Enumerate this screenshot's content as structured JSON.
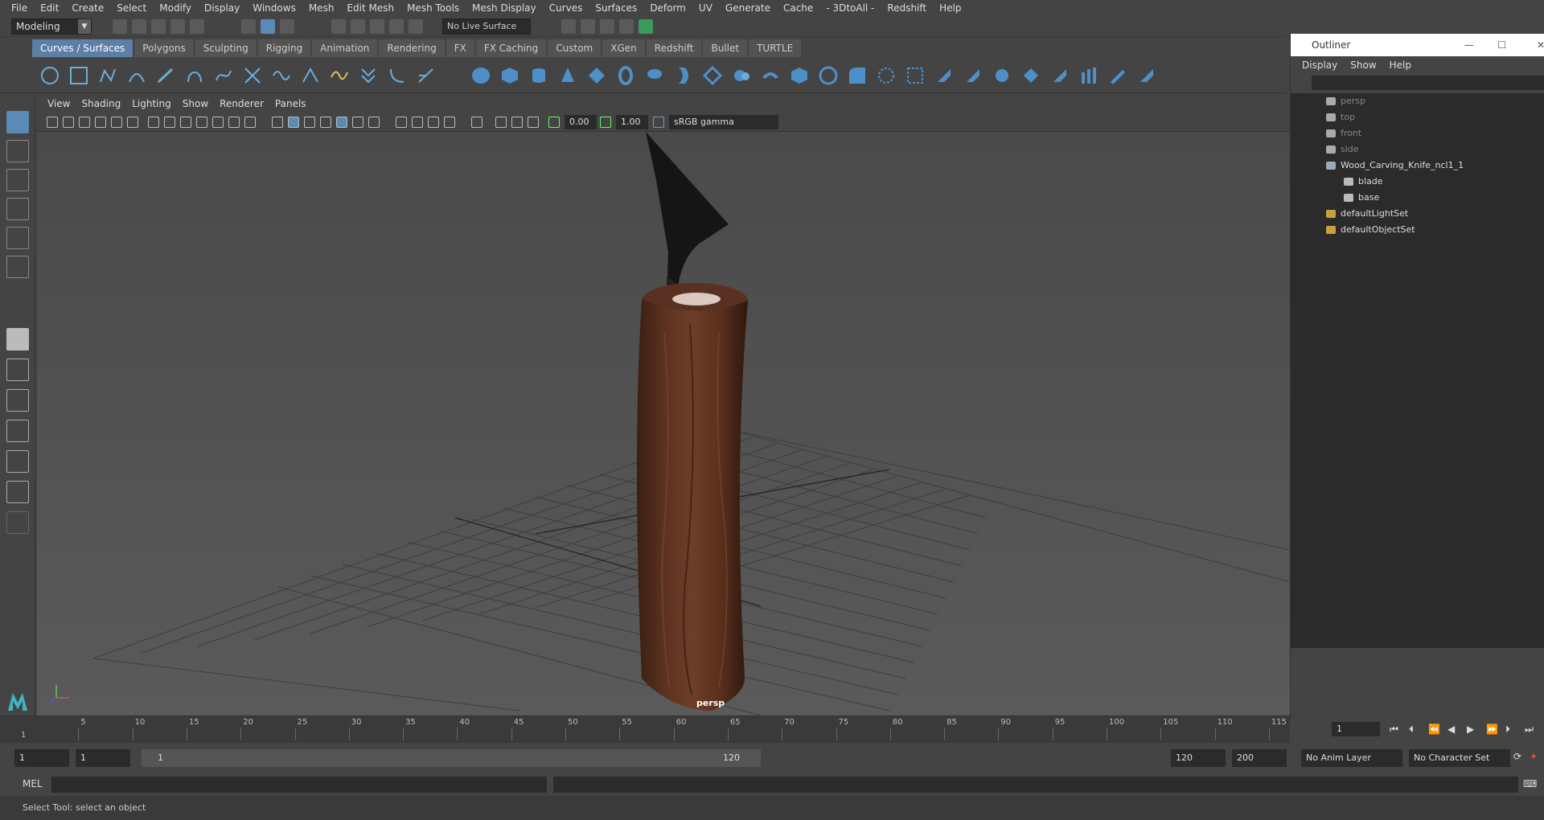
{
  "menubar": [
    "File",
    "Edit",
    "Create",
    "Select",
    "Modify",
    "Display",
    "Windows",
    "Mesh",
    "Edit Mesh",
    "Mesh Tools",
    "Mesh Display",
    "Curves",
    "Surfaces",
    "Deform",
    "UV",
    "Generate",
    "Cache",
    "- 3DtoAll -",
    "Redshift",
    "Help"
  ],
  "mode": "Modeling",
  "live_surface": "No Live Surface",
  "shelf_tabs": [
    "Curves / Surfaces",
    "Polygons",
    "Sculpting",
    "Rigging",
    "Animation",
    "Rendering",
    "FX",
    "FX Caching",
    "Custom",
    "XGen",
    "Redshift",
    "Bullet",
    "TURTLE"
  ],
  "viewport_menu": [
    "View",
    "Shading",
    "Lighting",
    "Show",
    "Renderer",
    "Panels"
  ],
  "viewport": {
    "exposure": "0.00",
    "gamma_value": "1.00",
    "color_space": "sRGB gamma",
    "camera_label": "persp"
  },
  "outliner": {
    "title": "Outliner",
    "menu": [
      "Display",
      "Show",
      "Help"
    ],
    "items": [
      {
        "label": "persp",
        "dim": true
      },
      {
        "label": "top",
        "dim": true
      },
      {
        "label": "front",
        "dim": true
      },
      {
        "label": "side",
        "dim": true
      },
      {
        "label": "Wood_Carving_Knife_ncl1_1",
        "dim": false
      },
      {
        "label": "blade",
        "dim": false
      },
      {
        "label": "base",
        "dim": false
      },
      {
        "label": "defaultLightSet",
        "dim": false
      },
      {
        "label": "defaultObjectSet",
        "dim": false
      }
    ]
  },
  "timeline": {
    "ticks": [
      "5",
      "10",
      "15",
      "20",
      "25",
      "30",
      "35",
      "40",
      "45",
      "50",
      "55",
      "60",
      "65",
      "70",
      "75",
      "80",
      "85",
      "90",
      "95",
      "100",
      "105",
      "110",
      "115"
    ],
    "start_label": "1",
    "current_frame": "1"
  },
  "range": {
    "start": "1",
    "playback_start": "1",
    "slider_start": "1",
    "slider_end": "120",
    "playback_end": "120",
    "end": "200",
    "anim_layer": "No Anim Layer",
    "character_set": "No Character Set"
  },
  "mel_label": "MEL",
  "help_line": "Select Tool: select an object"
}
